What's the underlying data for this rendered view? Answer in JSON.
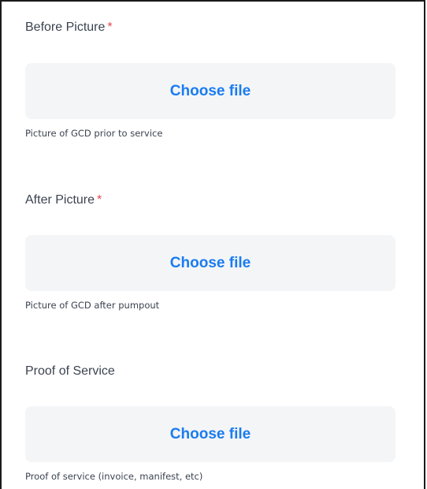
{
  "form": {
    "fields": [
      {
        "label": "Before Picture",
        "required_mark": "*",
        "button_label": "Choose file",
        "help_text": "Picture of GCD prior to service"
      },
      {
        "label": "After Picture",
        "required_mark": "*",
        "button_label": "Choose file",
        "help_text": "Picture of GCD after pumpout"
      },
      {
        "label": "Proof of Service",
        "required_mark": "",
        "button_label": "Choose file",
        "help_text": "Proof of service (invoice, manifest, etc)"
      }
    ]
  },
  "colors": {
    "label": "#3b4350",
    "required": "#e5484d",
    "button_background": "#f4f5f7",
    "button_text": "#1a7cf0"
  }
}
